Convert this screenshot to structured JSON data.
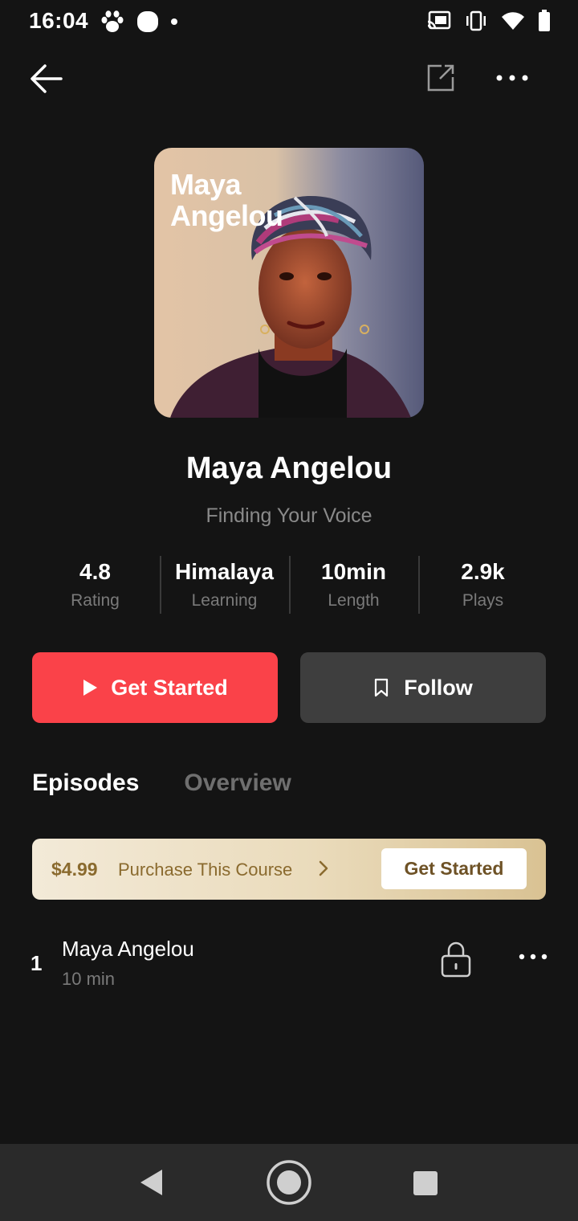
{
  "status_bar": {
    "time": "16:04",
    "icons_left": [
      "paw-icon",
      "circle-notification-icon",
      "dot-icon"
    ],
    "icons_right": [
      "cast-icon",
      "vibrate-icon",
      "wifi-icon",
      "battery-icon"
    ]
  },
  "top_nav": {
    "back_icon": "arrow-left-icon",
    "share_icon": "share-external-icon",
    "more_icon": "more-horizontal-icon"
  },
  "cover": {
    "title_line1": "Maya",
    "title_line2": "Angelou"
  },
  "course": {
    "title": "Maya Angelou",
    "subtitle": "Finding Your Voice"
  },
  "stats": [
    {
      "value": "4.8",
      "label": "Rating"
    },
    {
      "value": "Himalaya",
      "label": "Learning"
    },
    {
      "value": "10min",
      "label": "Length"
    },
    {
      "value": "2.9k",
      "label": "Plays"
    }
  ],
  "actions": {
    "primary_label": "Get Started",
    "follow_label": "Follow"
  },
  "tabs": {
    "active": "Episodes",
    "inactive": "Overview"
  },
  "purchase": {
    "price": "$4.99",
    "text": "Purchase This Course",
    "button_label": "Get Started"
  },
  "episodes": [
    {
      "number": "1",
      "title": "Maya Angelou",
      "duration": "10 min"
    }
  ],
  "colors": {
    "background": "#141414",
    "primary": "#fa4249",
    "follow_bg": "#3e3e3e",
    "gold_text": "#8a6a2e"
  }
}
